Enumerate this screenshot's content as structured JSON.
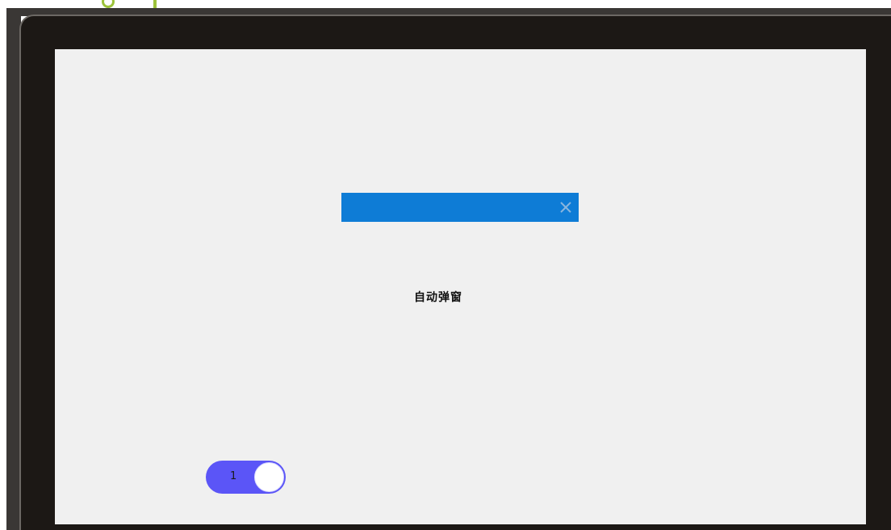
{
  "popup": {
    "close_icon": "close-icon",
    "message": "自动弹窗"
  },
  "toggle": {
    "label": "1",
    "state": "on",
    "color": "#5b55f7"
  },
  "colors": {
    "title_bar": "#0e7cd6",
    "screen_bg": "#f0f0f0",
    "bezel": "#1c1815"
  }
}
